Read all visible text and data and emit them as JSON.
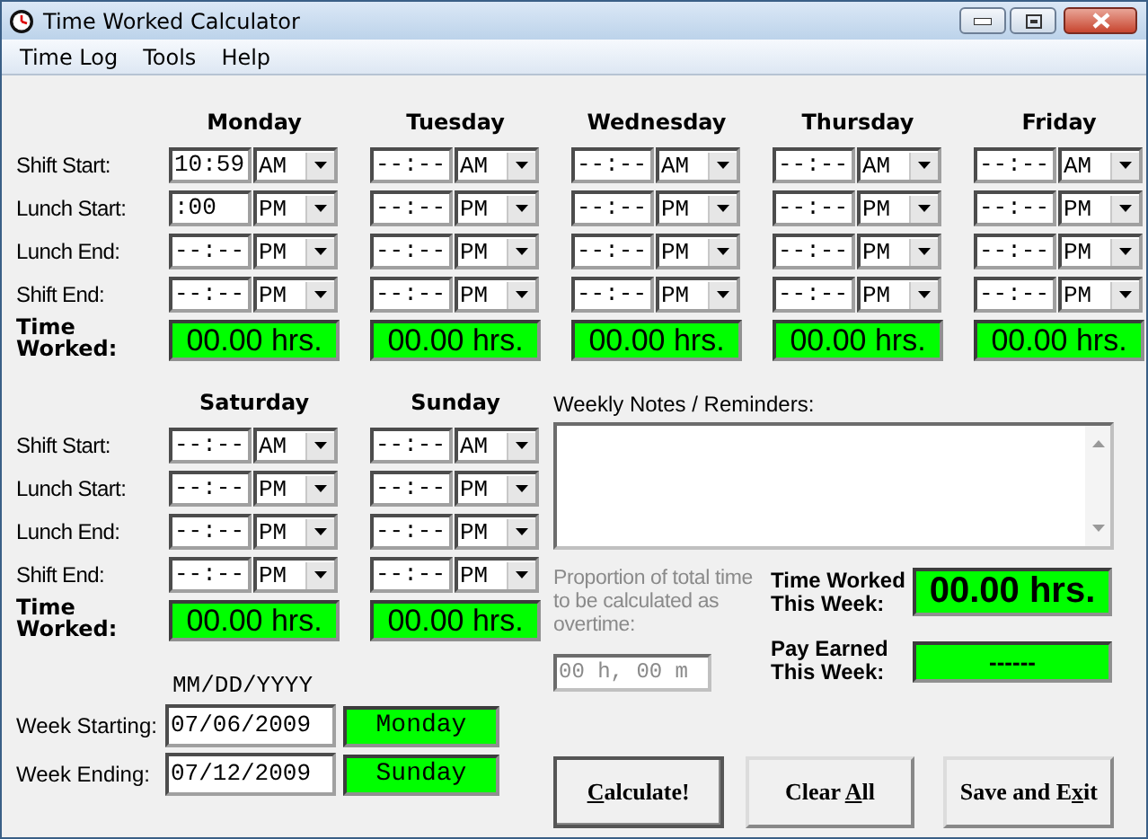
{
  "window": {
    "title": "Time Worked Calculator"
  },
  "menu": [
    {
      "label": "Time Log"
    },
    {
      "label": "Tools"
    },
    {
      "label": "Help"
    }
  ],
  "blocks": [
    {
      "row_labels": [
        "Shift Start:",
        "Lunch Start:",
        "Lunch End:",
        "Shift End:"
      ],
      "total_label": "Time Worked:",
      "days": [
        {
          "name": "Monday",
          "times": [
            {
              "time": "10:59",
              "meridiem": "AM"
            },
            {
              "time": ":00",
              "meridiem": "PM"
            },
            {
              "time": "--:--",
              "meridiem": "PM"
            },
            {
              "time": "--:--",
              "meridiem": "PM"
            }
          ],
          "total": "00.00 hrs."
        },
        {
          "name": "Tuesday",
          "times": [
            {
              "time": "--:--",
              "meridiem": "AM"
            },
            {
              "time": "--:--",
              "meridiem": "PM"
            },
            {
              "time": "--:--",
              "meridiem": "PM"
            },
            {
              "time": "--:--",
              "meridiem": "PM"
            }
          ],
          "total": "00.00 hrs."
        },
        {
          "name": "Wednesday",
          "times": [
            {
              "time": "--:--",
              "meridiem": "AM"
            },
            {
              "time": "--:--",
              "meridiem": "PM"
            },
            {
              "time": "--:--",
              "meridiem": "PM"
            },
            {
              "time": "--:--",
              "meridiem": "PM"
            }
          ],
          "total": "00.00 hrs."
        },
        {
          "name": "Thursday",
          "times": [
            {
              "time": "--:--",
              "meridiem": "AM"
            },
            {
              "time": "--:--",
              "meridiem": "PM"
            },
            {
              "time": "--:--",
              "meridiem": "PM"
            },
            {
              "time": "--:--",
              "meridiem": "PM"
            }
          ],
          "total": "00.00 hrs."
        },
        {
          "name": "Friday",
          "times": [
            {
              "time": "--:--",
              "meridiem": "AM"
            },
            {
              "time": "--:--",
              "meridiem": "PM"
            },
            {
              "time": "--:--",
              "meridiem": "PM"
            },
            {
              "time": "--:--",
              "meridiem": "PM"
            }
          ],
          "total": "00.00 hrs."
        }
      ]
    },
    {
      "row_labels": [
        "Shift Start:",
        "Lunch Start:",
        "Lunch End:",
        "Shift End:"
      ],
      "total_label": "Time Worked:",
      "days": [
        {
          "name": "Saturday",
          "times": [
            {
              "time": "--:--",
              "meridiem": "AM"
            },
            {
              "time": "--:--",
              "meridiem": "PM"
            },
            {
              "time": "--:--",
              "meridiem": "PM"
            },
            {
              "time": "--:--",
              "meridiem": "PM"
            }
          ],
          "total": "00.00 hrs."
        },
        {
          "name": "Sunday",
          "times": [
            {
              "time": "--:--",
              "meridiem": "AM"
            },
            {
              "time": "--:--",
              "meridiem": "PM"
            },
            {
              "time": "--:--",
              "meridiem": "PM"
            },
            {
              "time": "--:--",
              "meridiem": "PM"
            }
          ],
          "total": "00.00 hrs."
        }
      ]
    }
  ],
  "week": {
    "format_hint": "MM/DD/YYYY",
    "rows": [
      {
        "label": "Week Starting:",
        "date": "07/06/2009",
        "weekday": "Monday"
      },
      {
        "label": "Week Ending:",
        "date": "07/12/2009",
        "weekday": "Sunday"
      }
    ]
  },
  "notes": {
    "label": "Weekly Notes / Reminders:"
  },
  "overtime": {
    "label": "Proportion of total time to be calculated as overtime:",
    "value": "00 h, 00 m",
    "disabled": true
  },
  "summary": [
    {
      "label": "Time Worked This Week:",
      "value": "00.00 hrs.",
      "kind": "hours"
    },
    {
      "label": "Pay Earned This Week:",
      "value": "------",
      "kind": "pay"
    }
  ],
  "buttons": [
    {
      "parts": [
        {
          "text": "C",
          "underline": true
        },
        {
          "text": "alculate!",
          "underline": false
        }
      ],
      "default": true
    },
    {
      "parts": [
        {
          "text": "Clear ",
          "underline": false
        },
        {
          "text": "A",
          "underline": true
        },
        {
          "text": "ll",
          "underline": false
        }
      ],
      "default": false
    },
    {
      "parts": [
        {
          "text": "Save and E",
          "underline": false
        },
        {
          "text": "x",
          "underline": true
        },
        {
          "text": "it",
          "underline": false
        }
      ],
      "default": false
    }
  ]
}
